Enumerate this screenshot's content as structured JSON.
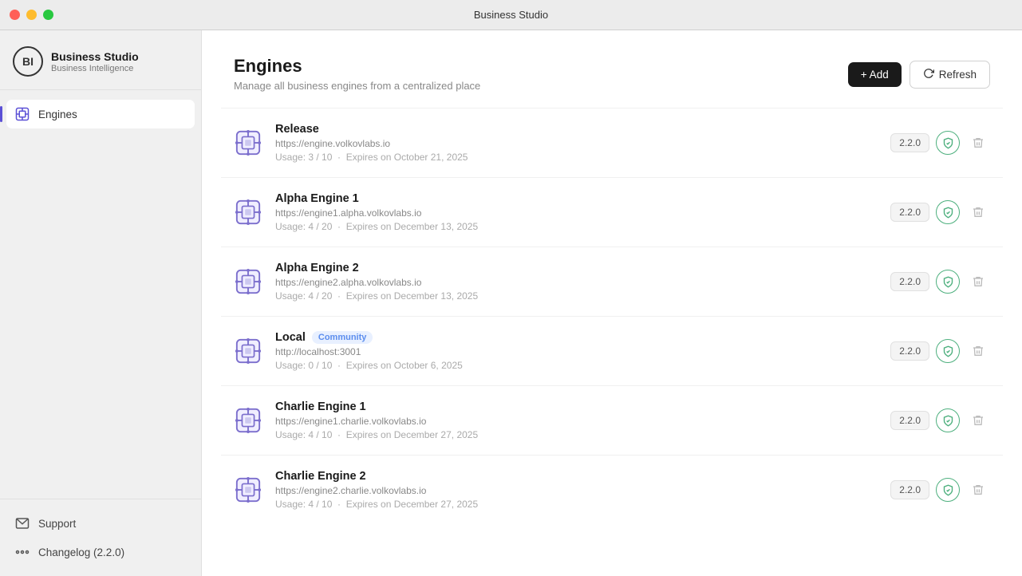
{
  "titlebar": {
    "title": "Business Studio"
  },
  "sidebar": {
    "app_name": "Business Studio",
    "app_sub": "Business Intelligence",
    "logo_text": "BI",
    "nav_items": [
      {
        "id": "engines",
        "label": "Engines",
        "active": true
      }
    ],
    "footer_items": [
      {
        "id": "support",
        "label": "Support"
      },
      {
        "id": "changelog",
        "label": "Changelog (2.2.0)"
      }
    ]
  },
  "page": {
    "title": "Engines",
    "subtitle": "Manage all business engines from a centralized place",
    "add_label": "+ Add",
    "refresh_label": "Refresh"
  },
  "engines": [
    {
      "name": "Release",
      "url": "https://engine.volkovlabs.io",
      "usage": "Usage: 3 / 10",
      "expires": "Expires on October 21, 2025",
      "version": "2.2.0",
      "badge": null
    },
    {
      "name": "Alpha Engine 1",
      "url": "https://engine1.alpha.volkovlabs.io",
      "usage": "Usage: 4 / 20",
      "expires": "Expires on December 13, 2025",
      "version": "2.2.0",
      "badge": null
    },
    {
      "name": "Alpha Engine 2",
      "url": "https://engine2.alpha.volkovlabs.io",
      "usage": "Usage: 4 / 20",
      "expires": "Expires on December 13, 2025",
      "version": "2.2.0",
      "badge": null
    },
    {
      "name": "Local",
      "url": "http://localhost:3001",
      "usage": "Usage: 0 / 10",
      "expires": "Expires on October 6, 2025",
      "version": "2.2.0",
      "badge": "Community"
    },
    {
      "name": "Charlie Engine 1",
      "url": "https://engine1.charlie.volkovlabs.io",
      "usage": "Usage: 4 / 10",
      "expires": "Expires on December 27, 2025",
      "version": "2.2.0",
      "badge": null
    },
    {
      "name": "Charlie Engine 2",
      "url": "https://engine2.charlie.volkovlabs.io",
      "usage": "Usage: 4 / 10",
      "expires": "Expires on December 27, 2025",
      "version": "2.2.0",
      "badge": null
    }
  ]
}
